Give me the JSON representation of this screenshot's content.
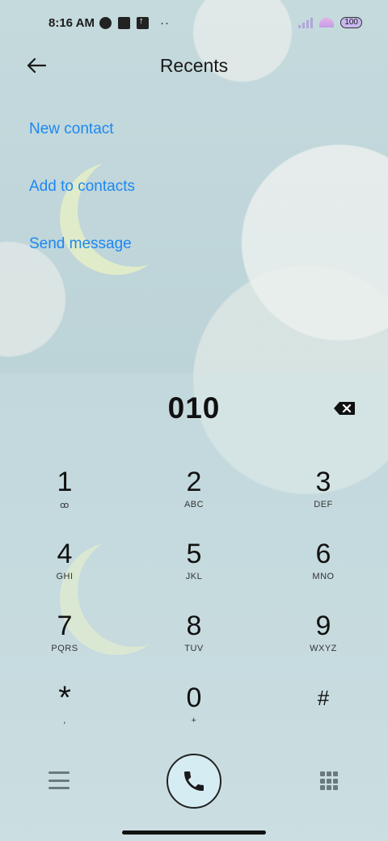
{
  "status_bar": {
    "time": "8:16 AM",
    "more_indicator": "··",
    "battery": "100"
  },
  "header": {
    "title": "Recents"
  },
  "actions": [
    {
      "label": "New contact"
    },
    {
      "label": "Add to contacts"
    },
    {
      "label": "Send message"
    }
  ],
  "dialer": {
    "number": "010",
    "keys": [
      {
        "digit": "1",
        "letters": "ꝏ"
      },
      {
        "digit": "2",
        "letters": "ABC"
      },
      {
        "digit": "3",
        "letters": "DEF"
      },
      {
        "digit": "4",
        "letters": "GHI"
      },
      {
        "digit": "5",
        "letters": "JKL"
      },
      {
        "digit": "6",
        "letters": "MNO"
      },
      {
        "digit": "7",
        "letters": "PQRS"
      },
      {
        "digit": "8",
        "letters": "TUV"
      },
      {
        "digit": "9",
        "letters": "WXYZ"
      },
      {
        "digit": "*",
        "letters": ","
      },
      {
        "digit": "0",
        "letters": "+"
      },
      {
        "digit": "#",
        "letters": ""
      }
    ]
  },
  "colors": {
    "accent": "#1d88f0",
    "call_button_bg": "#d5ecf2"
  }
}
